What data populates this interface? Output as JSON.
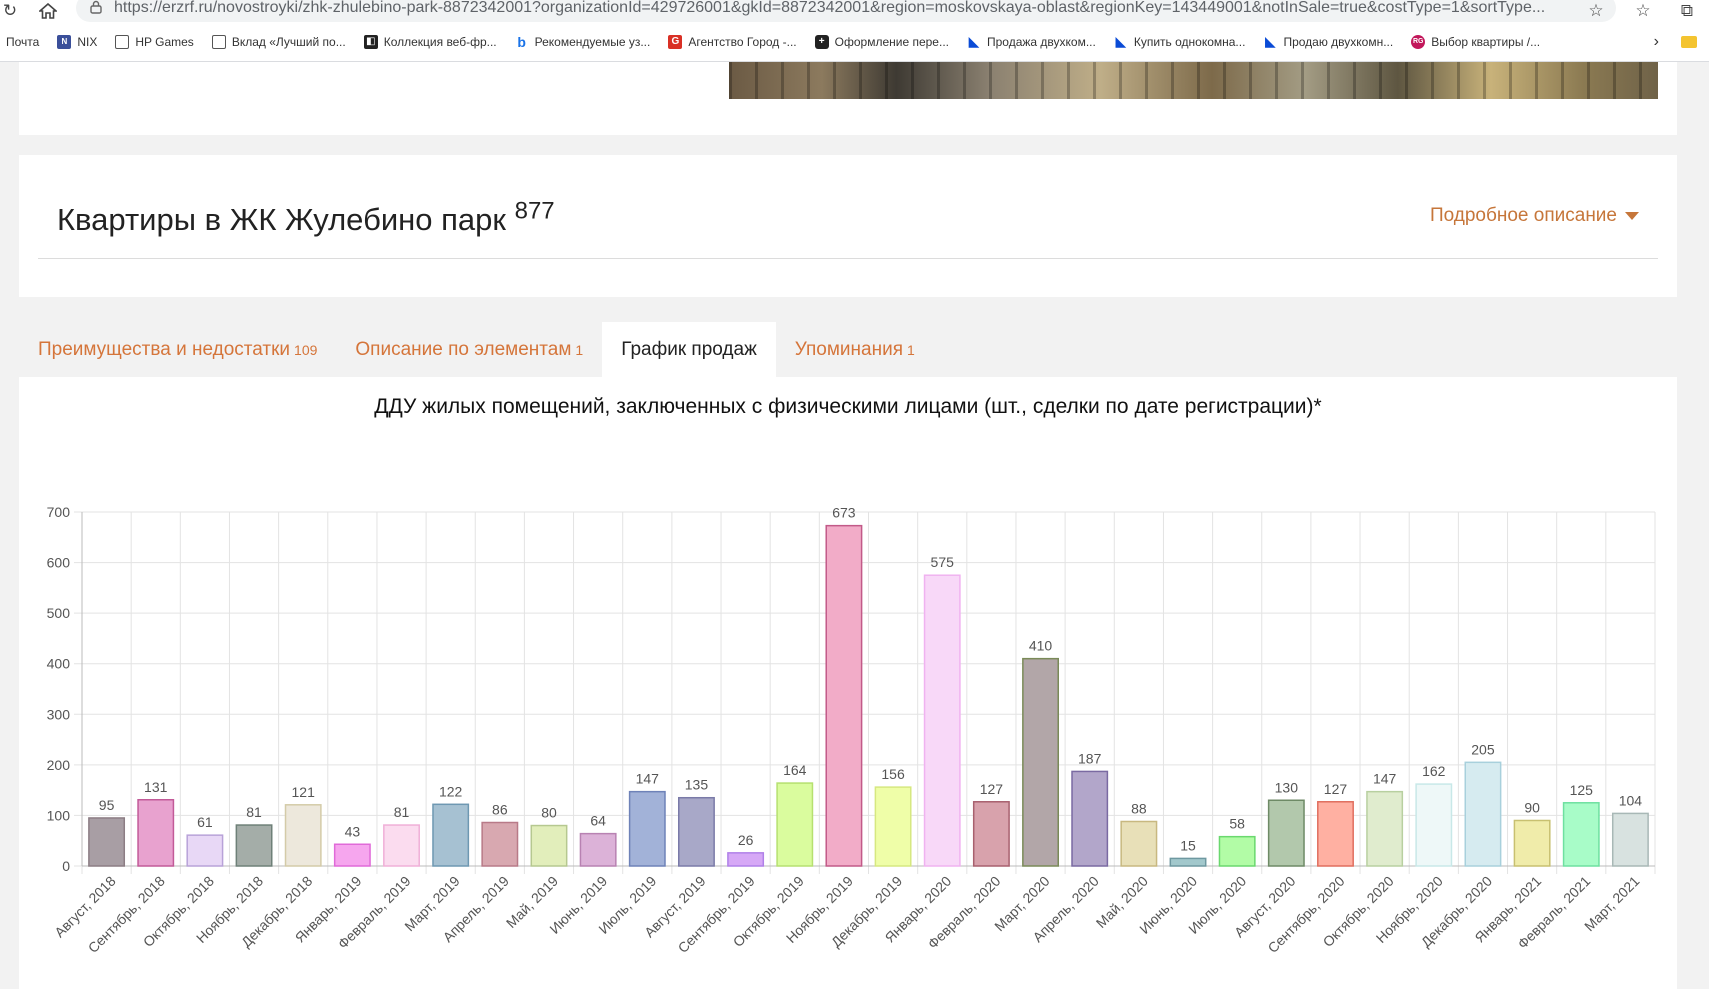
{
  "browser": {
    "url_host": "https://erzrf.ru",
    "url_path": "/novostroyki/zhk-zhulebino-park-8872342001?organizationId=429726001&gkId=8872342001&region=moskovskaya-oblast&regionKey=143449001&notInSale=true&costType=1&sortType...",
    "bookmarks": [
      {
        "label": "Почта",
        "icon": "mail-icon",
        "color": "#ffffff"
      },
      {
        "label": "NIX",
        "icon": "nix-icon",
        "color": "#3a4f9a"
      },
      {
        "label": "HP Games",
        "icon": "page-icon",
        "color": "#ffffff"
      },
      {
        "label": "Вклад «Лучший по...",
        "icon": "page-icon",
        "color": "#ffffff"
      },
      {
        "label": "Коллекция веб-фр...",
        "icon": "collection-icon",
        "color": "#222222"
      },
      {
        "label": "Рекомендуемые уз...",
        "icon": "bing-icon",
        "color": "#1a73e8"
      },
      {
        "label": "Агентство Город -...",
        "icon": "g-icon",
        "color": "#d93025"
      },
      {
        "label": "Оформление пере...",
        "icon": "plus-icon",
        "color": "#222222"
      },
      {
        "label": "Продажа двухком...",
        "icon": "avito-icon",
        "color": "#0a4bd6"
      },
      {
        "label": "Купить однокомна...",
        "icon": "avito-icon",
        "color": "#0a4bd6"
      },
      {
        "label": "Продаю двухкомн...",
        "icon": "avito-icon",
        "color": "#0a4bd6"
      },
      {
        "label": "Выбор квартиры /...",
        "icon": "rg-icon",
        "color": "#c2185b"
      }
    ]
  },
  "header": {
    "title": "Квартиры в ЖК Жулебино парк",
    "title_count": "877",
    "description_link": "Подробное описание"
  },
  "tabs": [
    {
      "label": "Преимущества и недостатки",
      "count": "109",
      "active": false
    },
    {
      "label": "Описание по элементам",
      "count": "1",
      "active": false
    },
    {
      "label": "График продаж",
      "count": "",
      "active": true
    },
    {
      "label": "Упоминания",
      "count": "1",
      "active": false
    }
  ],
  "chart_data": {
    "type": "bar",
    "title": "ДДУ жилых помещений, заключенных с физическими лицами (шт., сделки по дате регистрации)*",
    "xlabel": "",
    "ylabel": "",
    "ylim": [
      0,
      700
    ],
    "yticks": [
      0,
      100,
      200,
      300,
      400,
      500,
      600,
      700
    ],
    "grid": true,
    "categories": [
      "Август, 2018",
      "Сентябрь, 2018",
      "Октябрь, 2018",
      "Ноябрь, 2018",
      "Декабрь, 2018",
      "Январь, 2019",
      "Февраль, 2019",
      "Март, 2019",
      "Апрель, 2019",
      "Май, 2019",
      "Июнь, 2019",
      "Июль, 2019",
      "Август, 2019",
      "Сентябрь, 2019",
      "Октябрь, 2019",
      "Ноябрь, 2019",
      "Декабрь, 2019",
      "Январь, 2020",
      "Февраль, 2020",
      "Март, 2020",
      "Апрель, 2020",
      "Май, 2020",
      "Июнь, 2020",
      "Июль, 2020",
      "Август, 2020",
      "Сентябрь, 2020",
      "Октябрь, 2020",
      "Ноябрь, 2020",
      "Декабрь, 2020",
      "Январь, 2021",
      "Февраль, 2021",
      "Март, 2021"
    ],
    "values": [
      95,
      131,
      61,
      81,
      121,
      43,
      81,
      122,
      86,
      80,
      64,
      147,
      135,
      26,
      164,
      673,
      156,
      575,
      127,
      410,
      187,
      88,
      15,
      58,
      130,
      127,
      147,
      162,
      205,
      90,
      125,
      104
    ],
    "colors": [
      "#a89ea4",
      "#e8a2cf",
      "#e8d8f6",
      "#a4ada8",
      "#ede8dc",
      "#f6a6ee",
      "#fbdcef",
      "#a6c1d2",
      "#d8a8b0",
      "#e2eebb",
      "#dcb2d8",
      "#a2b2d8",
      "#a8a8c8",
      "#d6a8f6",
      "#dafc9e",
      "#f2acc8",
      "#effea8",
      "#f8d8f8",
      "#d8a2ac",
      "#b2a6a8",
      "#b2a6ca",
      "#e8e0b8",
      "#a2c8cc",
      "#b2fca6",
      "#b2c8ac",
      "#ffb0a2",
      "#e0ecce",
      "#eef8f8",
      "#d6ebf0",
      "#f0ecaa",
      "#a8fcc8",
      "#d8e2e0"
    ],
    "borders": [
      "#8c7d84",
      "#c25a98",
      "#b8a2d8",
      "#6e8078",
      "#d4cba8",
      "#e06ad8",
      "#f0b0d8",
      "#6e98b2",
      "#b87a88",
      "#b6c890",
      "#b882b2",
      "#6e82b8",
      "#7a7aa8",
      "#b080e8",
      "#b6e070",
      "#c25a88",
      "#d6e880",
      "#f0b2f0",
      "#a8606e",
      "#7a8a58",
      "#7a6aa2",
      "#c8b880",
      "#6e98a0",
      "#6ad86e",
      "#6e8a66",
      "#e06e5e",
      "#b8d0a0",
      "#c8e8e8",
      "#a8d0dc",
      "#c8c070",
      "#6ee0a0",
      "#a8b8b6"
    ]
  }
}
